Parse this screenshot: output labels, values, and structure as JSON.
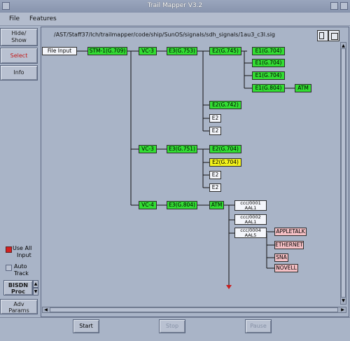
{
  "window": {
    "title": "Trail Mapper V3.2"
  },
  "menu": {
    "file": "File",
    "features": "Features"
  },
  "left_panel": {
    "hide_show_line1": "Hide/",
    "hide_show_line2": "Show",
    "select": "Select",
    "info": "Info",
    "use_all_input_line1": "Use All",
    "use_all_input_line2": "Input",
    "auto_track_line1": "Auto",
    "auto_track_line2": "Track",
    "bisdn_line1": "BISDN",
    "bisdn_line2": "Proc",
    "adv_params_line1": "Adv",
    "adv_params_line2": "Params"
  },
  "path": "/AST/Staff37/lch/trailmapper/code/ship/SunOS/signals/sdh_signals/1au3_c3l.sig",
  "tree": {
    "file_input": "File Input",
    "stm1": "STM-1(G.709)",
    "vc3_a": "VC-3",
    "e3_a": "E3(G.753)",
    "e2_a": "E2(G.745)",
    "e1_1": "E1(G.704)",
    "e1_2": "E1(G.704)",
    "e1_3": "E1(G.704)",
    "e1_4": "E1(G.804)",
    "atm_a": "ATM",
    "e2_742": "E2(G.742)",
    "e2_b1": "E2",
    "e2_b2": "E2",
    "vc3_b": "VC-3",
    "e3_b": "E3(G.751)",
    "e2_704": "E2(G.704)",
    "e2_704_y": "E2(G.704)",
    "e2_c1": "E2",
    "e2_c2": "E2",
    "vc4": "VC-4",
    "e3_804": "E3(G.804)",
    "atm_b": "ATM",
    "ccc1_l1": "ccc/0001",
    "ccc1_l2": "AAL1",
    "ccc2_l1": "ccc/0002",
    "ccc2_l2": "AAL1",
    "ccc4_l1": "ccc/0004",
    "ccc4_l2": "AAL5",
    "appletalk": "APPLETALK",
    "ethernet": "ETHERNET",
    "sna": "SNA",
    "novell": "NOVELL"
  },
  "bottom": {
    "start": "Start",
    "stop": "Stop",
    "pause": "Pause"
  },
  "colors": {
    "green": "#33dd33",
    "yellow": "#f2f21a",
    "pink": "#f5c0c5",
    "background": "#a9b4c7"
  }
}
